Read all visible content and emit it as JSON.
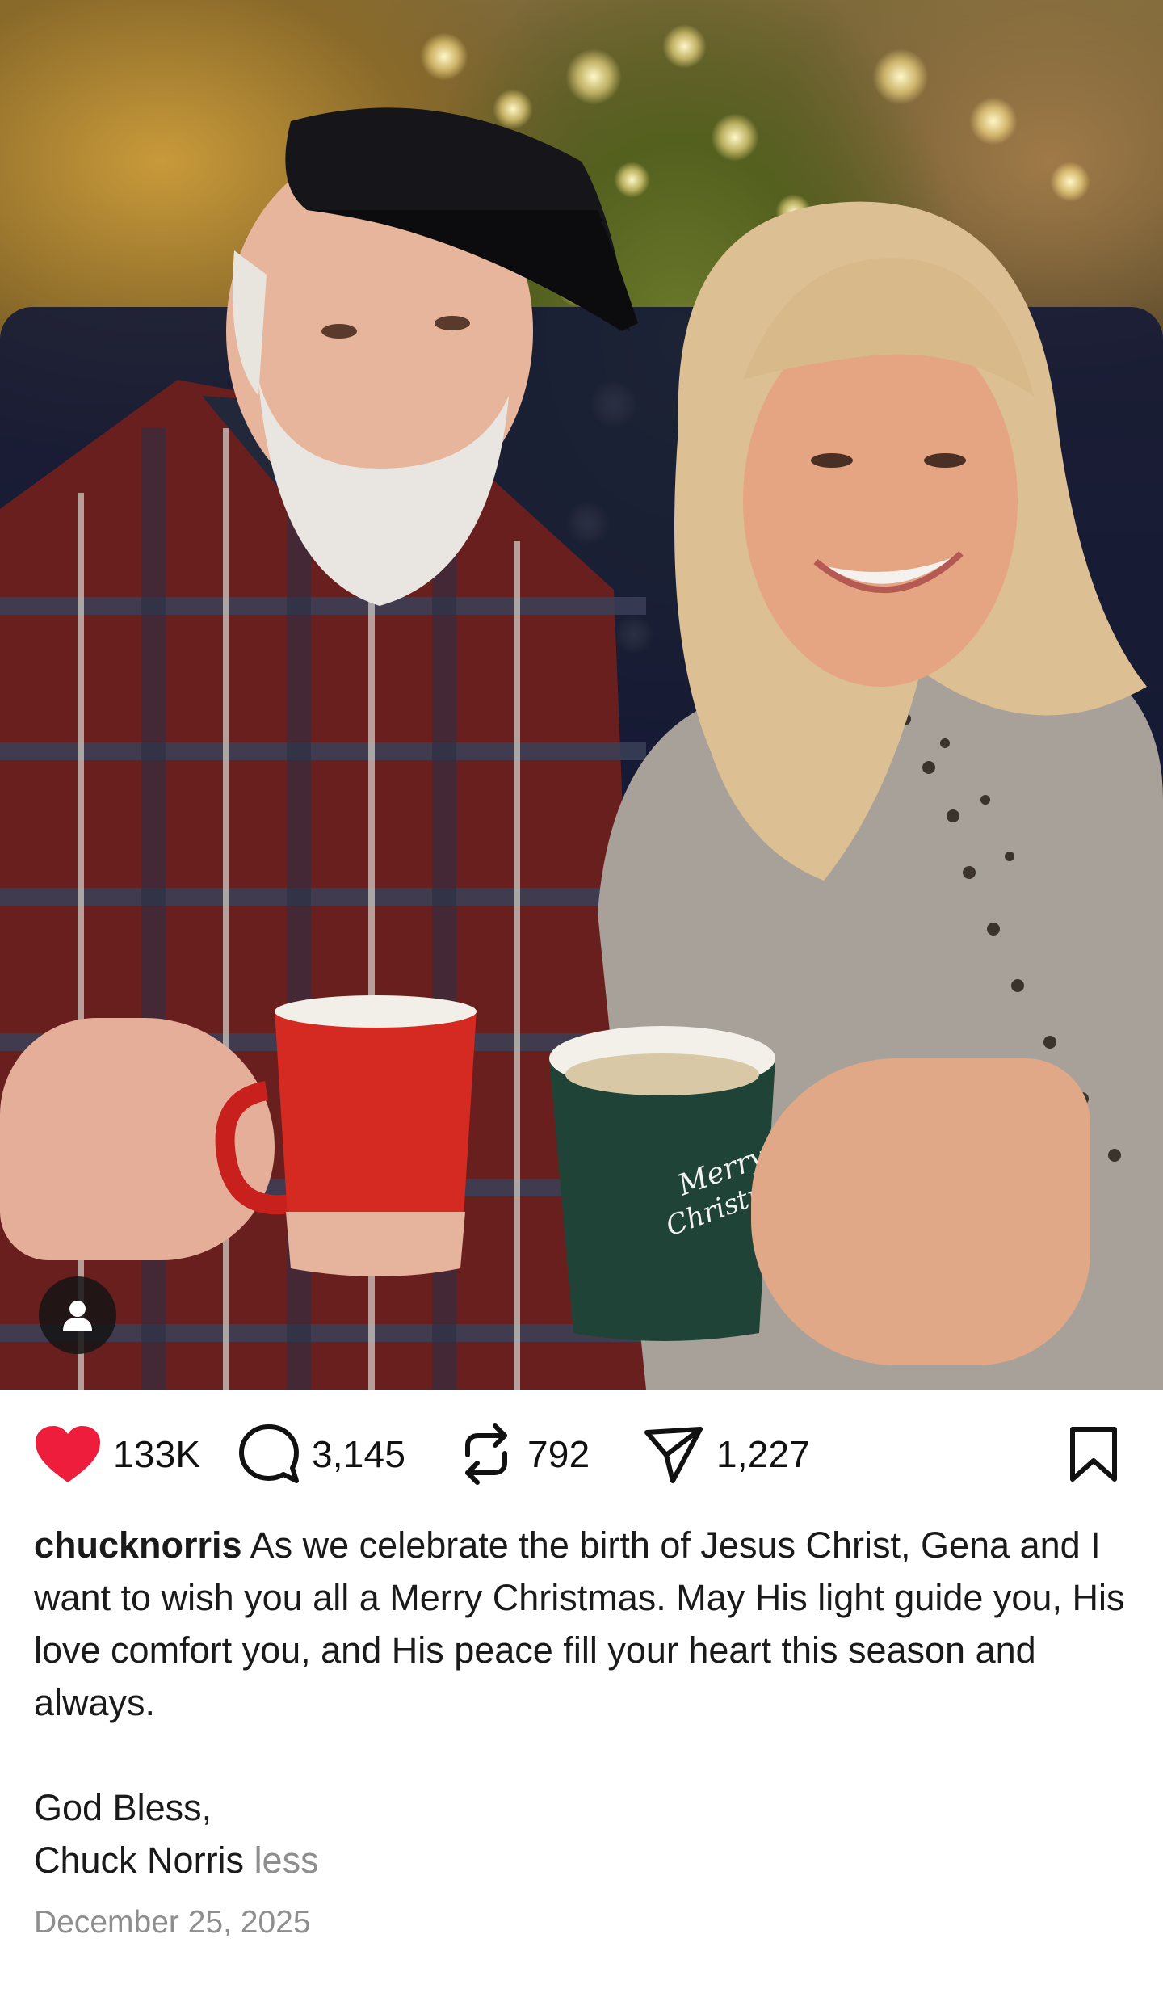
{
  "post": {
    "likes": "133K",
    "comments": "3,145",
    "reposts": "792",
    "shares": "1,227",
    "username": "chucknorris",
    "caption_line1": "As we celebrate the birth of Jesus Christ, Gena and I want to wish you all a Merry Christmas. May His light guide you, His love comfort you, and His peace fill your heart this season and always.",
    "caption_sign1": "God Bless,",
    "caption_sign2": "Chuck Norris",
    "less_label": "less",
    "date": "December 25, 2025"
  },
  "photo": {
    "mug_text_1": "Merry",
    "mug_text_2": "Christmas"
  },
  "colors": {
    "like": "#ee1d3c",
    "muted": "#8e8e8e",
    "text": "#111111"
  },
  "icons": {
    "like": "heart-icon",
    "comment": "comment-icon",
    "repost": "repost-icon",
    "share": "share-icon",
    "bookmark": "bookmark-icon",
    "tag": "user-tag-icon"
  }
}
